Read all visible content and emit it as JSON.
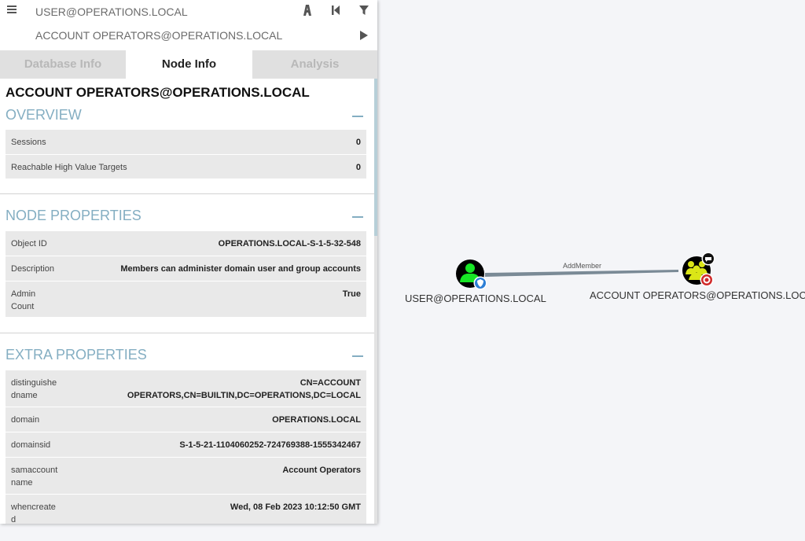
{
  "search": {
    "start_value": "USER@OPERATIONS.LOCAL",
    "target_value": "ACCOUNT OPERATORS@OPERATIONS.LOCAL"
  },
  "tabs": [
    {
      "label": "Database Info",
      "active": false
    },
    {
      "label": "Node Info",
      "active": true
    },
    {
      "label": "Analysis",
      "active": false
    }
  ],
  "node": {
    "title": "ACCOUNT OPERATORS@OPERATIONS.LOCAL",
    "overview": {
      "header": "OVERVIEW",
      "rows": [
        {
          "key": "Sessions",
          "value": "0"
        },
        {
          "key": "Reachable High Value Targets",
          "value": "0"
        }
      ]
    },
    "node_properties": {
      "header": "NODE PROPERTIES",
      "rows": [
        {
          "key": "Object ID",
          "value": "OPERATIONS.LOCAL-S-1-5-32-548"
        },
        {
          "key": "Description",
          "value": "Members can administer domain user and group accounts"
        },
        {
          "key": "Admin Count",
          "value": "True"
        }
      ]
    },
    "extra_properties": {
      "header": "EXTRA PROPERTIES",
      "rows": [
        {
          "key": "distinguishedname",
          "value": "CN=ACCOUNT OPERATORS,CN=BUILTIN,DC=OPERATIONS,DC=LOCAL"
        },
        {
          "key": "domain",
          "value": "OPERATIONS.LOCAL"
        },
        {
          "key": "domainsid",
          "value": "S-1-5-21-1104060252-724769388-1555342467"
        },
        {
          "key": "samaccountname",
          "value": "Account Operators"
        },
        {
          "key": "whencreated",
          "value": "Wed, 08 Feb 2023 10:12:50 GMT"
        }
      ]
    }
  },
  "graph": {
    "user_node_label": "USER@OPERATIONS.LOCAL",
    "group_node_label": "ACCOUNT OPERATORS@OPERATIONS.LOCAL",
    "edge_label": "AddMember",
    "colors": {
      "user_fill": "#17e625",
      "group_fill": "#dbe617",
      "node_bg": "#000000",
      "edge": "#7a8a96",
      "accent": "#84aec2"
    },
    "icons": [
      "user-icon",
      "group-icon",
      "shield-icon",
      "target-icon",
      "chat-icon"
    ]
  },
  "toolbar_icons": [
    "menu-icon",
    "pathfinding-icon",
    "back-icon",
    "filter-icon",
    "play-icon"
  ]
}
